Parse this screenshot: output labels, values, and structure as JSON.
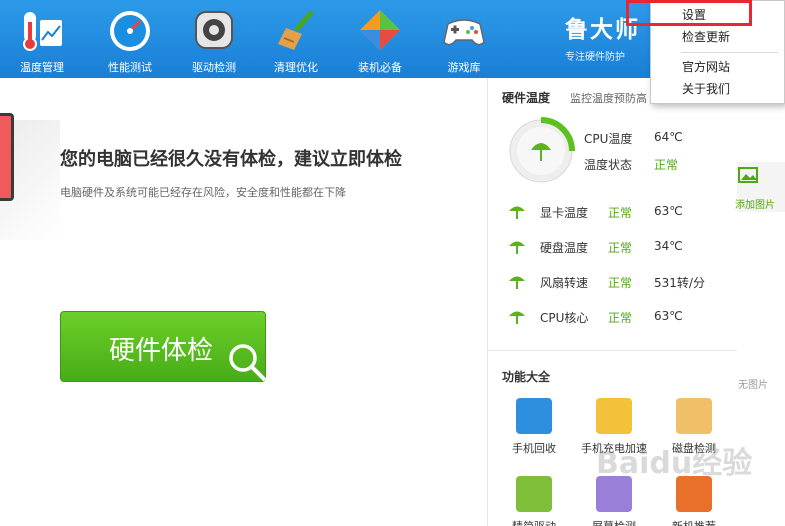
{
  "toolbar": {
    "items": [
      {
        "label": "温度管理",
        "icon": "thermometer-icon"
      },
      {
        "label": "性能测试",
        "icon": "speedometer-icon"
      },
      {
        "label": "驱动检测",
        "icon": "gear-chip-icon"
      },
      {
        "label": "清理优化",
        "icon": "broom-icon"
      },
      {
        "label": "装机必备",
        "icon": "box-icon"
      },
      {
        "label": "游戏库",
        "icon": "gamepad-icon"
      }
    ],
    "brand": "鲁大师",
    "brand_sub": "专注硬件防护"
  },
  "menu": {
    "items": [
      "设置",
      "检查更新",
      "官方网站",
      "关于我们"
    ],
    "highlighted": "设置",
    "highlight_color": "#e8282e"
  },
  "main": {
    "title": "您的电脑已经很久没有体检，建议立即体检",
    "subtitle": "电脑硬件及系统可能已经存在风险，安全度和性能都在下降",
    "button": "硬件体检",
    "button_color": "#52b51c"
  },
  "panel": {
    "temp_title": "硬件温度",
    "temp_sub": "监控温度预防高",
    "cpu": {
      "temp_label": "CPU温度",
      "temp_value": "64℃",
      "status_label": "温度状态",
      "status_value": "正常"
    },
    "rows": [
      {
        "label": "显卡温度",
        "status": "正常",
        "value": "63℃"
      },
      {
        "label": "硬盘温度",
        "status": "正常",
        "value": "34℃"
      },
      {
        "label": "风扇转速",
        "status": "正常",
        "value": "531转/分"
      },
      {
        "label": "CPU核心",
        "status": "正常",
        "value": "63℃"
      }
    ],
    "func_title": "功能大全",
    "functions": [
      {
        "label": "手机回收",
        "icon": "phone-recycle-icon"
      },
      {
        "label": "手机充电加速",
        "icon": "charge-boost-icon"
      },
      {
        "label": "磁盘检测",
        "icon": "disk-check-icon"
      },
      {
        "label": "精简驱动",
        "icon": "driver-slim-icon"
      },
      {
        "label": "屏幕检测",
        "icon": "screen-check-icon"
      },
      {
        "label": "新机推荐",
        "icon": "new-pc-icon"
      }
    ]
  },
  "side": {
    "add_image": "添加图片",
    "no_image": "无图片"
  },
  "watermark": "Baidu经验"
}
